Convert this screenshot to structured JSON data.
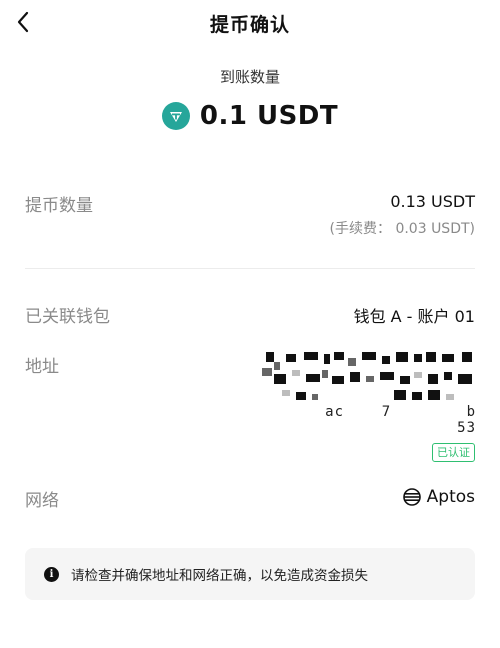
{
  "header": {
    "title": "提币确认",
    "back_icon": "chevron-left-icon"
  },
  "summary": {
    "label": "到账数量",
    "amount": "0.1 USDT",
    "token_icon": "tether-icon",
    "token_color": "#26a69a",
    "token_symbol": "₮"
  },
  "withdraw": {
    "label": "提币数量",
    "value": "0.13 USDT",
    "fee": "(手续费： 0.03 USDT)"
  },
  "wallet": {
    "label": "已关联钱包",
    "value": "钱包 A - 账户 01"
  },
  "address": {
    "label": "地址",
    "tail": "ac    7        b",
    "tail_end": "53",
    "verified_badge": "已认证",
    "verified_color": "#2fbf71"
  },
  "network": {
    "label": "网络",
    "value": "Aptos",
    "icon": "aptos-icon"
  },
  "notice": {
    "icon": "info-icon",
    "text": "请检查并确保地址和网络正确，以免造成资金损失"
  }
}
